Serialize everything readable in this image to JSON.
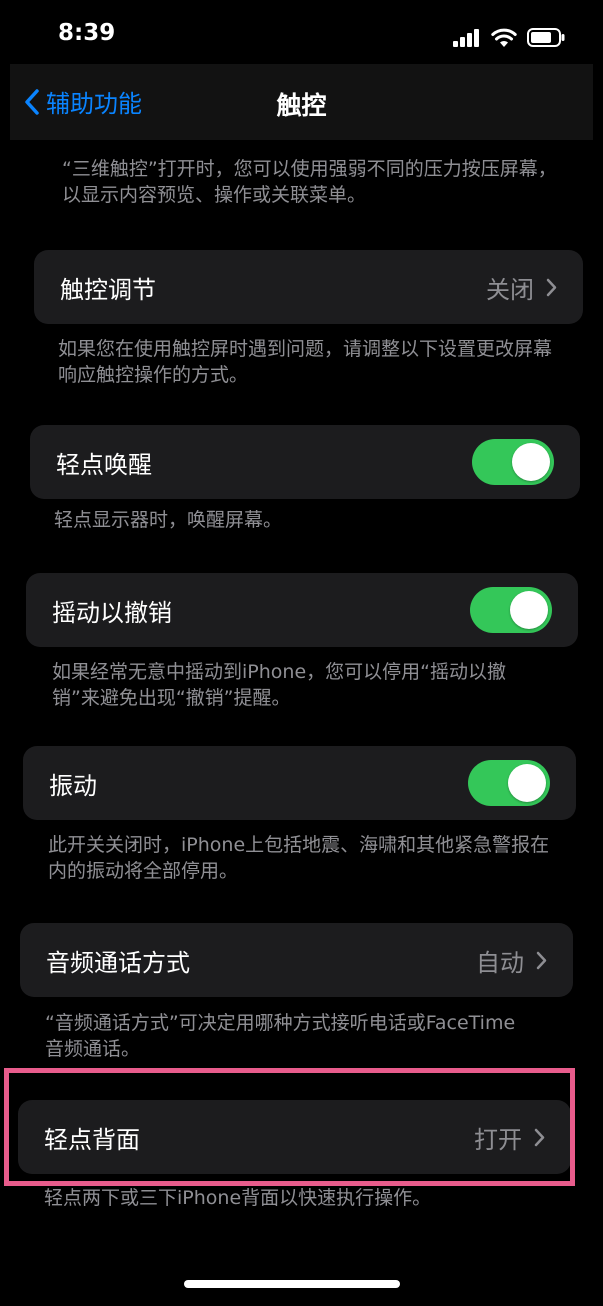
{
  "status_bar": {
    "time": "8:39"
  },
  "nav": {
    "back_label": "辅助功能",
    "title": "触控"
  },
  "top_note": "“三维触控”打开时，您可以使用强弱不同的压力按压屏幕，以显示内容预览、操作或关联菜单。",
  "touch_accommodations": {
    "label": "触控调节",
    "value": "关闭",
    "note": "如果您在使用触控屏时遇到问题，请调整以下设置更改屏幕响应触控操作的方式。"
  },
  "tap_to_wake": {
    "label": "轻点唤醒",
    "on": true,
    "note": "轻点显示器时，唤醒屏幕。"
  },
  "shake_to_undo": {
    "label": "摇动以撤销",
    "on": true,
    "note": "如果经常无意中摇动到iPhone，您可以停用“摇动以撤销”来避免出现“撤销”提醒。"
  },
  "vibration": {
    "label": "振动",
    "on": true,
    "note": "此开关关闭时，iPhone上包括地震、海啸和其他紧急警报在内的振动将全部停用。"
  },
  "call_audio_routing": {
    "label": "音频通话方式",
    "value": "自动",
    "note": "“音频通话方式”可决定用哪种方式接听电话或FaceTime音频通话。"
  },
  "back_tap": {
    "label": "轻点背面",
    "value": "打开",
    "note": "轻点两下或三下iPhone背面以快速执行操作。"
  },
  "colors": {
    "accent": "#0a84ff",
    "toggle_on": "#34c759",
    "highlight": "#e85c8c",
    "cell_bg": "#1c1c1e"
  }
}
